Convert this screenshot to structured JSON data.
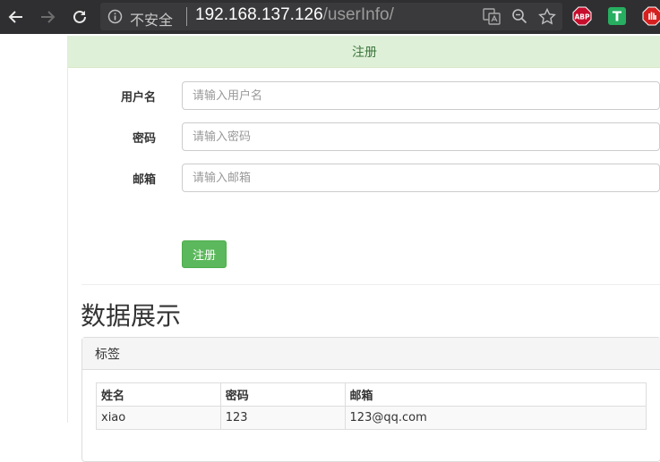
{
  "browser": {
    "security_label": "不安全",
    "url_host": "192.168.137.126",
    "url_path": "/userInfo/",
    "extensions": [
      "ABP",
      "T"
    ]
  },
  "form": {
    "header": "注册",
    "fields": [
      {
        "label": "用户名",
        "placeholder": "请输入用户名"
      },
      {
        "label": "密码",
        "placeholder": "请输入密码"
      },
      {
        "label": "邮箱",
        "placeholder": "请输入邮箱"
      }
    ],
    "submit_label": "注册"
  },
  "data_section": {
    "title": "数据展示",
    "panel_heading": "标签",
    "table": {
      "headers": [
        "姓名",
        "密码",
        "邮箱"
      ],
      "rows": [
        [
          "xiao",
          "123",
          "123@qq.com"
        ]
      ]
    }
  },
  "colors": {
    "chrome_bg": "#2f2f31",
    "success_bg": "#dff0d8",
    "success_text": "#3c763d",
    "button_green": "#5cb85c"
  }
}
